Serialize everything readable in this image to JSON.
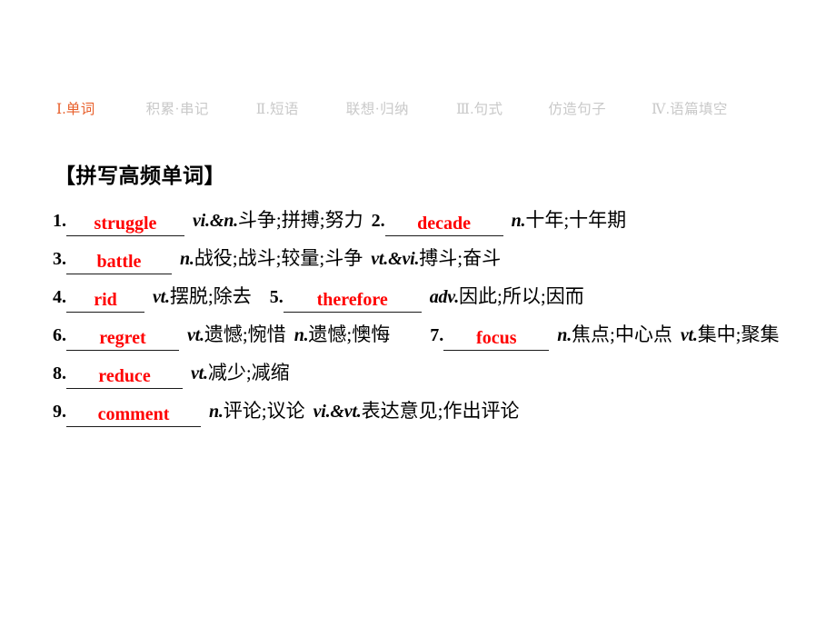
{
  "nav": {
    "items": [
      {
        "label": "Ⅰ.单词",
        "active": true
      },
      {
        "label": "积累·串记",
        "active": false
      },
      {
        "label": "Ⅱ.短语",
        "active": false
      },
      {
        "label": "联想·归纳",
        "active": false
      },
      {
        "label": "Ⅲ.句式",
        "active": false
      },
      {
        "label": "仿造句子",
        "active": false
      },
      {
        "label": "Ⅳ.语篇填空",
        "active": false
      }
    ],
    "active_color": "#e8602c",
    "inactive_color": "#c9c9c9"
  },
  "heading": "【拼写高频单词】",
  "answer_color": "#ff0000",
  "words": [
    {
      "number": "1.",
      "answer": "struggle",
      "pos1": "vi.&n.",
      "meaning1": "斗争;拼搏;努力"
    },
    {
      "number": "2.",
      "answer": "decade",
      "pos1": "n.",
      "meaning1": "十年;十年期"
    },
    {
      "number": "3.",
      "answer": "battle",
      "pos1": "n.",
      "meaning1": "战役;战斗;较量;斗争",
      "pos2": "vt.&vi.",
      "meaning2": "搏斗;奋斗"
    },
    {
      "number": "4.",
      "answer": "rid",
      "pos1": "vt.",
      "meaning1": "摆脱;除去"
    },
    {
      "number": "5.",
      "answer": "therefore",
      "pos1": "adv.",
      "meaning1": "因此;所以;因而"
    },
    {
      "number": "6.",
      "answer": "regret",
      "pos1": "vt.",
      "meaning1": "遗憾;惋惜",
      "pos2": "n.",
      "meaning2": "遗憾;懊悔"
    },
    {
      "number": "7.",
      "answer": "focus",
      "pos1": "n.",
      "meaning1": "焦点;中心点",
      "pos2": "vt.",
      "meaning2": "集中;聚集"
    },
    {
      "number": "8.",
      "answer": "reduce",
      "pos1": "vt.",
      "meaning1": "减少;减缩"
    },
    {
      "number": "9.",
      "answer": "comment",
      "pos1": "n.",
      "meaning1": "评论;议论",
      "pos2": "vi.&vt.",
      "meaning2": "表达意见;作出评论"
    }
  ]
}
